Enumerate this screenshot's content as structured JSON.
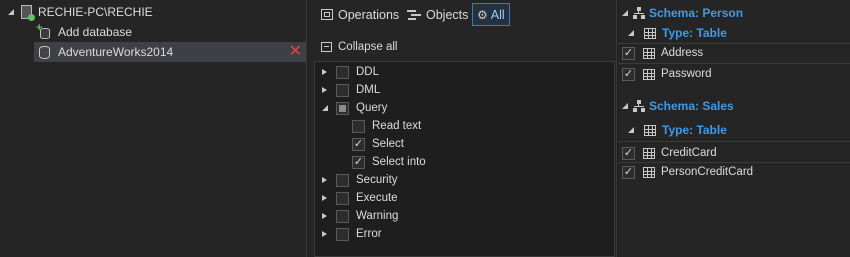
{
  "servers_panel": {
    "server_name": "RECHIE-PC\\RECHIE",
    "add_database_label": "Add database",
    "database_name": "AdventureWorks2014"
  },
  "filter_panel": {
    "tabs": [
      {
        "label": "Operations"
      },
      {
        "label": "Objects"
      },
      {
        "label": "All",
        "active": true
      }
    ],
    "collapse_all_label": "Collapse all",
    "categories": [
      {
        "label": "DDL",
        "expanded": false,
        "state": "unchecked"
      },
      {
        "label": "DML",
        "expanded": false,
        "state": "unchecked"
      },
      {
        "label": "Query",
        "expanded": true,
        "state": "partial",
        "children": [
          {
            "label": "Read text",
            "checked": false
          },
          {
            "label": "Select",
            "checked": true
          },
          {
            "label": "Select into",
            "checked": true
          }
        ]
      },
      {
        "label": "Security",
        "expanded": false,
        "state": "unchecked"
      },
      {
        "label": "Execute",
        "expanded": false,
        "state": "unchecked"
      },
      {
        "label": "Warning",
        "expanded": false,
        "state": "unchecked"
      },
      {
        "label": "Error",
        "expanded": false,
        "state": "unchecked"
      }
    ]
  },
  "objects_panel": {
    "schemas": [
      {
        "label": "Schema: Person",
        "type_label": "Type: Table",
        "tables": [
          {
            "name": "Address",
            "checked": true
          },
          {
            "name": "Password",
            "checked": true
          }
        ]
      },
      {
        "label": "Schema: Sales",
        "type_label": "Type: Table",
        "tables": [
          {
            "name": "CreditCard",
            "checked": true
          },
          {
            "name": "PersonCreditCard",
            "checked": true
          }
        ]
      }
    ]
  },
  "colors": {
    "accent_blue": "#3d9be9",
    "remove_red": "#e0443a",
    "add_green": "#5fc35f"
  }
}
